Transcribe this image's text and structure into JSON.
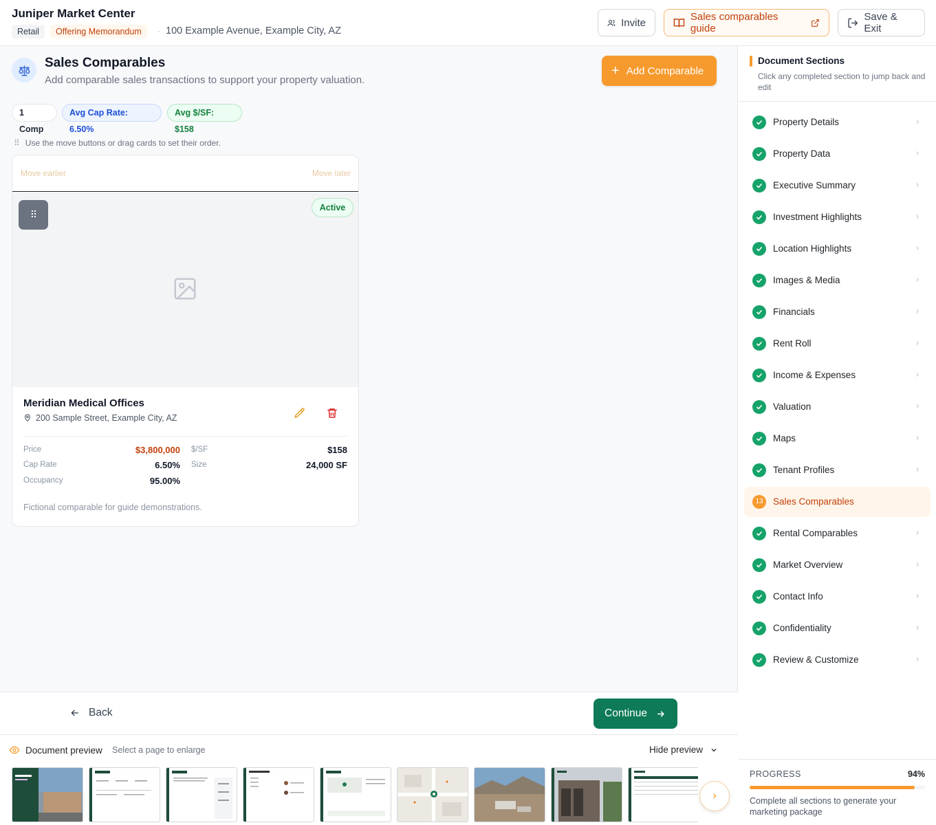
{
  "header": {
    "title": "Juniper Market Center",
    "tag_type": "Retail",
    "tag_doc": "Offering Memorandum",
    "address": "100 Example Avenue, Example City, AZ",
    "invite_label": "Invite",
    "guide_label": "Sales comparables guide",
    "save_label": "Save & Exit"
  },
  "section": {
    "title": "Sales Comparables",
    "subtitle": "Add comparable sales transactions to support your property valuation.",
    "add_label": "Add Comparable",
    "chips": {
      "count": "1 Comp",
      "cap_rate": "Avg Cap Rate: 6.50%",
      "price_sf": "Avg $/SF: $158"
    },
    "hint": "Use the move buttons or drag cards to set their order."
  },
  "comparable": {
    "move_earlier": "Move earlier",
    "move_later": "Move later",
    "status": "Active",
    "name": "Meridian Medical Offices",
    "address": "200 Sample Street, Example City, AZ",
    "stats": {
      "price_label": "Price",
      "price": "$3,800,000",
      "psf_label": "$/SF",
      "psf": "$158",
      "cap_label": "Cap Rate",
      "cap": "6.50%",
      "size_label": "Size",
      "size": "24,000 SF",
      "occ_label": "Occupancy",
      "occ": "95.00%"
    },
    "note": "Fictional comparable for guide demonstrations."
  },
  "footer": {
    "back_label": "Back",
    "continue_label": "Continue"
  },
  "preview": {
    "label": "Document preview",
    "sub": "Select a page to enlarge",
    "hide_label": "Hide preview"
  },
  "sidebar": {
    "title": "Document Sections",
    "subtitle": "Click any completed section to jump back and edit",
    "items": [
      {
        "label": "Property Details",
        "status": "complete"
      },
      {
        "label": "Property Data",
        "status": "complete"
      },
      {
        "label": "Executive Summary",
        "status": "complete"
      },
      {
        "label": "Investment Highlights",
        "status": "complete"
      },
      {
        "label": "Location Highlights",
        "status": "complete"
      },
      {
        "label": "Images & Media",
        "status": "complete"
      },
      {
        "label": "Financials",
        "status": "complete"
      },
      {
        "label": "Rent Roll",
        "status": "complete"
      },
      {
        "label": "Income & Expenses",
        "status": "complete"
      },
      {
        "label": "Valuation",
        "status": "complete"
      },
      {
        "label": "Maps",
        "status": "complete"
      },
      {
        "label": "Tenant Profiles",
        "status": "complete"
      },
      {
        "label": "Sales Comparables",
        "status": "active",
        "number": "13"
      },
      {
        "label": "Rental Comparables",
        "status": "complete"
      },
      {
        "label": "Market Overview",
        "status": "complete"
      },
      {
        "label": "Contact Info",
        "status": "complete"
      },
      {
        "label": "Confidentiality",
        "status": "complete"
      },
      {
        "label": "Review & Customize",
        "status": "complete"
      }
    ],
    "progress_label": "PROGRESS",
    "progress_text": "94%",
    "progress_value": 0.94,
    "progress_note": "Complete all sections to generate your marketing package"
  },
  "colors": {
    "accent": "#f79a2d",
    "success": "#16a36a",
    "primary_green": "#0e7a57"
  }
}
